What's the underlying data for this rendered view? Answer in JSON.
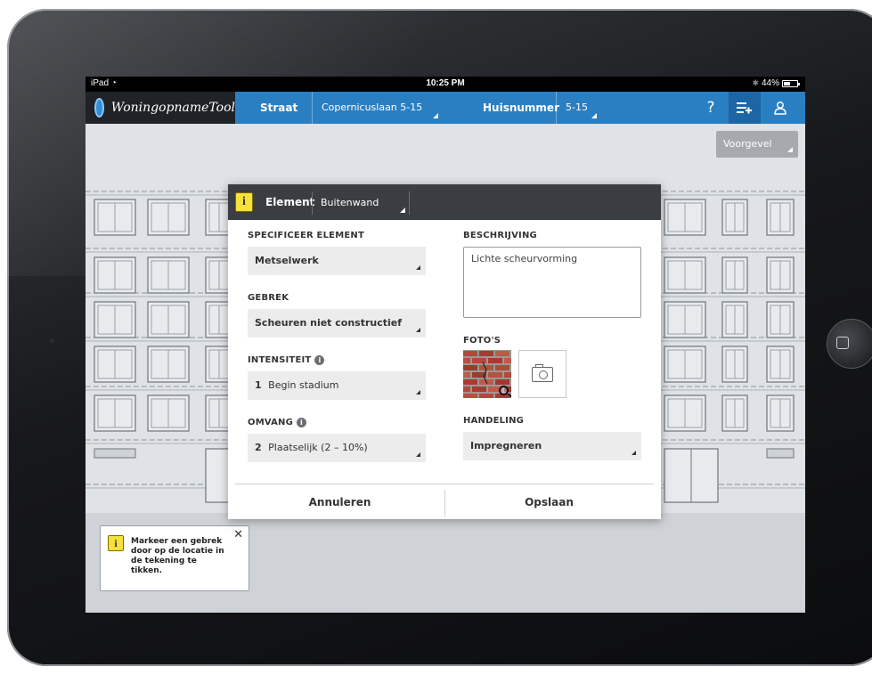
{
  "statusbar": {
    "carrier": "iPad",
    "time": "10:25 PM",
    "battery": "44%"
  },
  "appbar": {
    "brand": "WoningopnameTool",
    "street_label": "Straat",
    "street_value": "Copernicuslaan 5-15",
    "number_label": "Huisnummer",
    "number_value": "5-15",
    "help_icon": "?"
  },
  "view_select": {
    "value": "Voorgevel"
  },
  "hint": {
    "text": "Markeer een gebrek door op de locatie in de tekening te tikken."
  },
  "modal": {
    "header_label": "Element",
    "header_value": "Buitenwand",
    "specify_label": "SPECIFICEER ELEMENT",
    "specify_value": "Metselwerk",
    "defect_label": "GEBREK",
    "defect_value": "Scheuren niet constructief",
    "intensity_label": "INTENSITEIT",
    "intensity_num": "1",
    "intensity_value": "Begin stadium",
    "extent_label": "OMVANG",
    "extent_num": "2",
    "extent_value": "Plaatselijk (2 – 10%)",
    "description_label": "BESCHRIJVING",
    "description_value": "Lichte scheurvorming",
    "photos_label": "FOTO'S",
    "action_label": "HANDELING",
    "action_value": "Impregneren",
    "cancel_label": "Annuleren",
    "save_label": "Opslaan"
  },
  "colors": {
    "appbar": "#2a7fc3",
    "brand_bg": "#1f2226",
    "info_yellow": "#f7e23b",
    "modal_header": "#3a3d41"
  },
  "icons": [
    "wifi-icon",
    "bluetooth-icon",
    "battery-icon",
    "globe-logo-icon",
    "help-icon",
    "add-list-icon",
    "user-icon",
    "info-icon",
    "close-icon",
    "camera-icon",
    "magnify-icon",
    "home-button-icon"
  ]
}
